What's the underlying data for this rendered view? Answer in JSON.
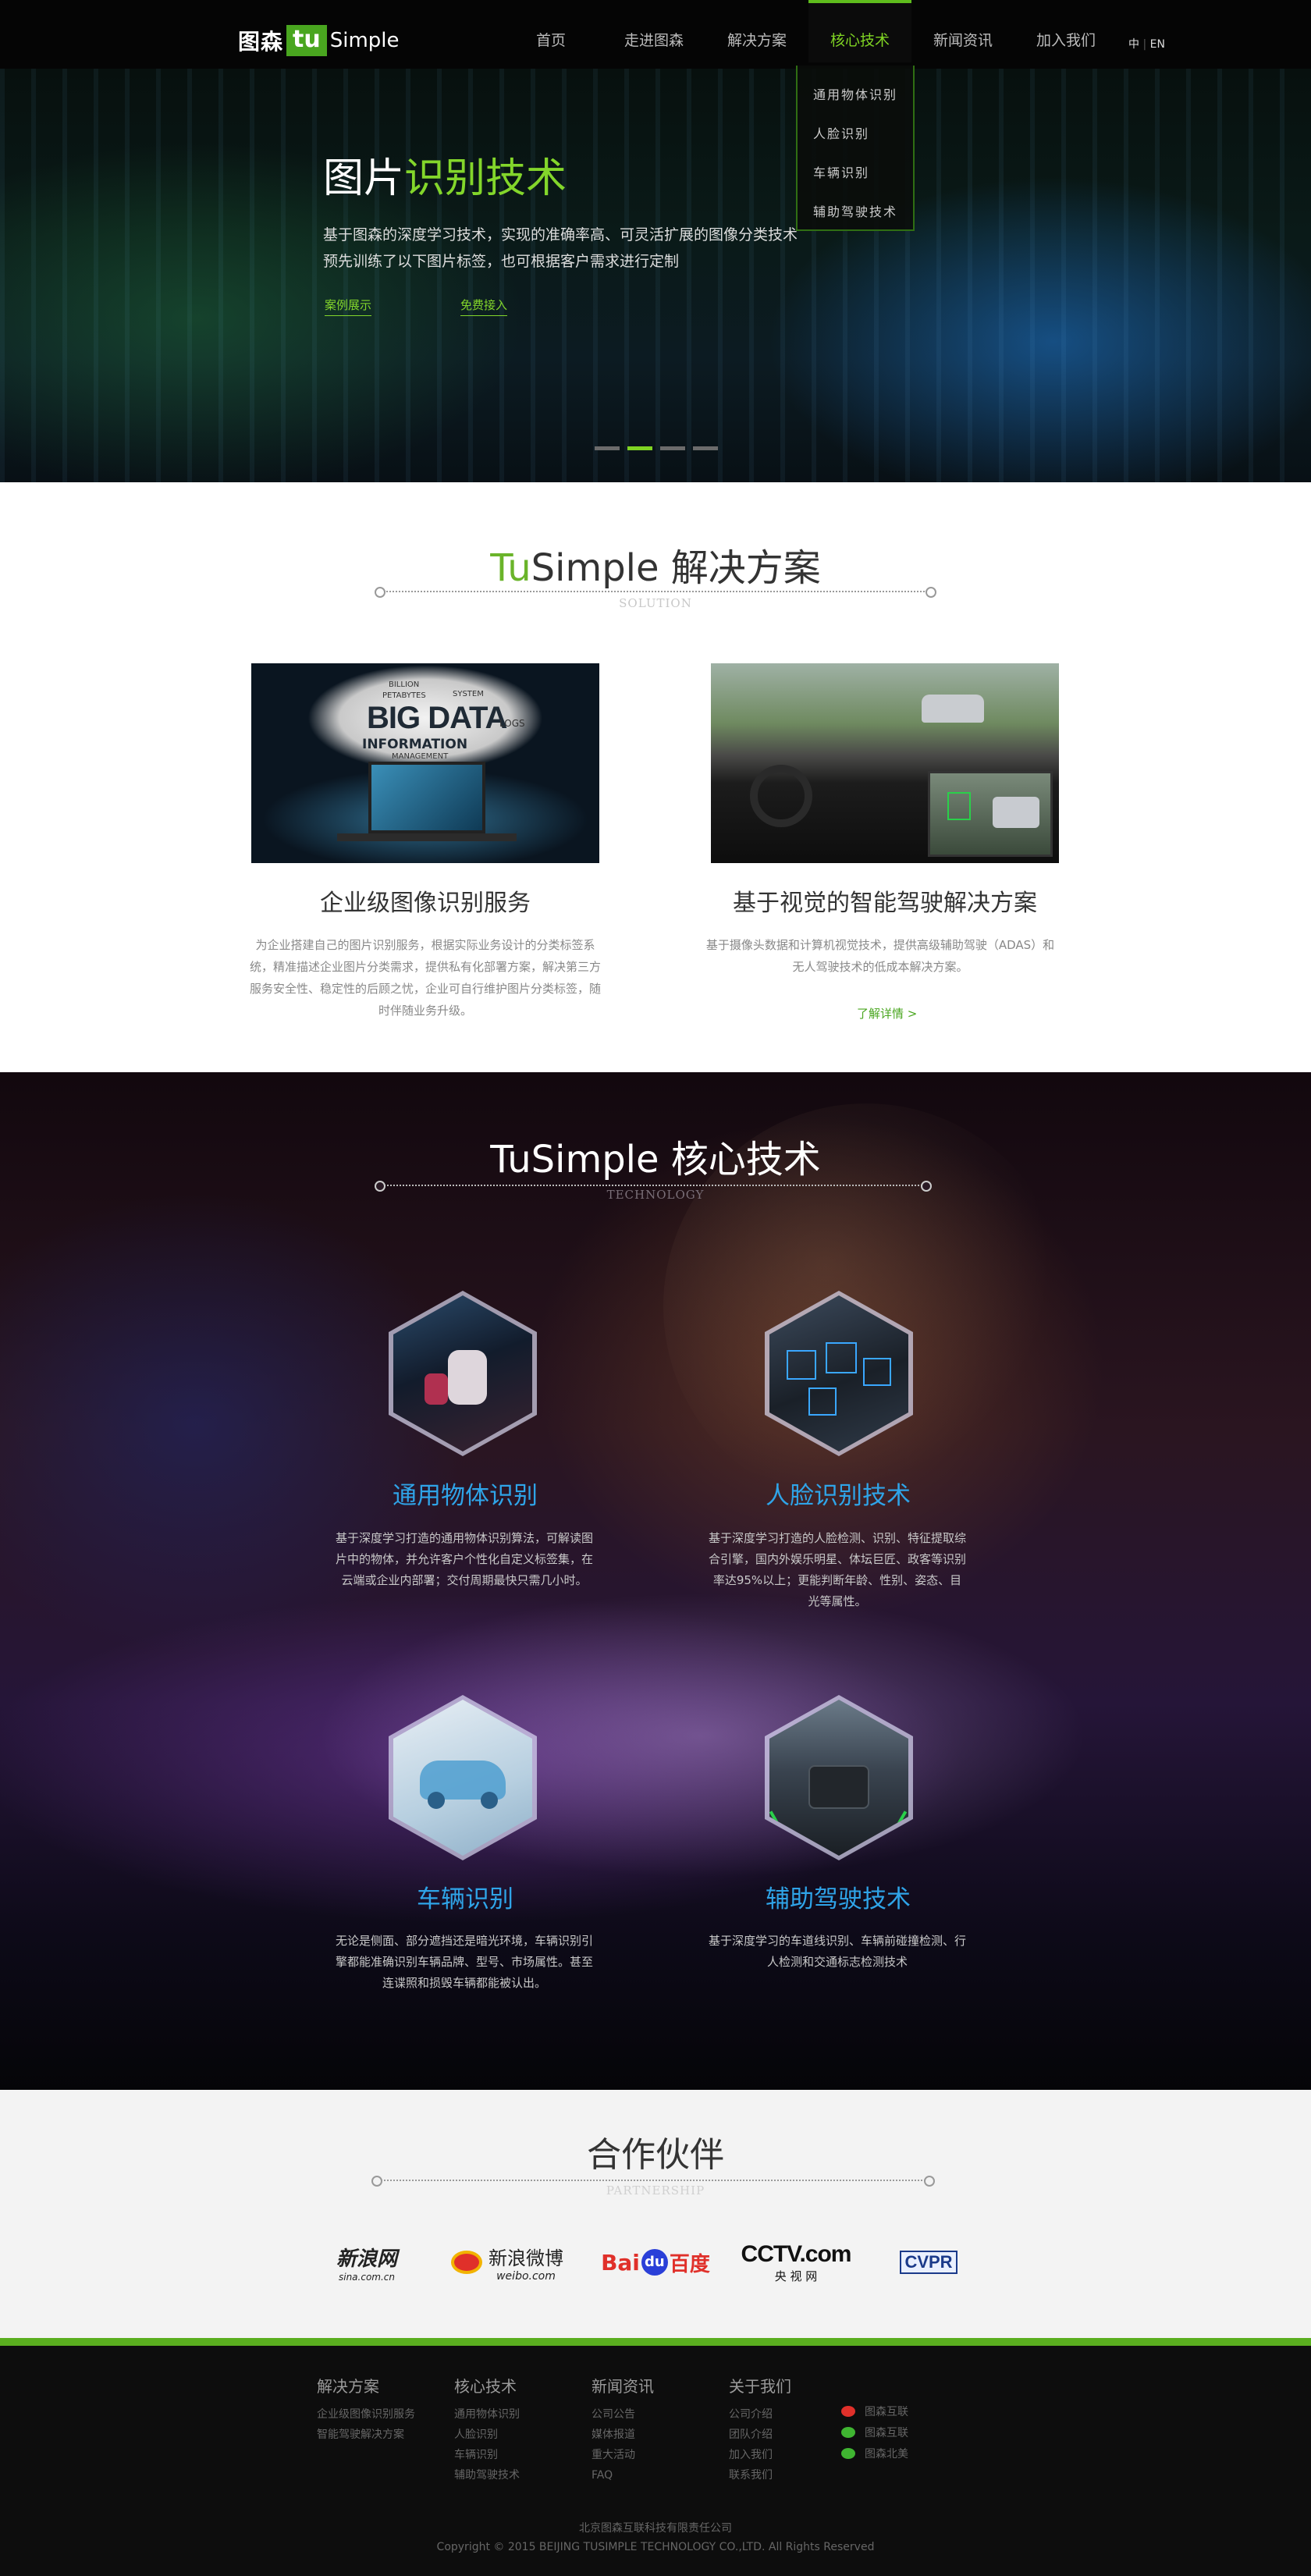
{
  "header": {
    "logo_cn": "图森",
    "logo_tu": "tu",
    "logo_en": "Simple",
    "nav": [
      {
        "label": "首页"
      },
      {
        "label": "走进图森"
      },
      {
        "label": "解决方案"
      },
      {
        "label": "核心技术",
        "active": true
      },
      {
        "label": "新闻资讯"
      },
      {
        "label": "加入我们"
      }
    ],
    "lang_cn": "中",
    "lang_sep": " | ",
    "lang_en": "EN",
    "dropdown": [
      "通用物体识别",
      "人脸识别",
      "车辆识别",
      "辅助驾驶技术"
    ]
  },
  "hero": {
    "title_white": "图片",
    "title_green": "识别技术",
    "desc_line1": "基于图森的深度学习技术，实现的准确率高、可灵活扩展的图像分类技术",
    "desc_line2": "预先训练了以下图片标签，也可根据客户需求进行定制",
    "link_cases": "案例展示",
    "link_trial": "免费接入",
    "slides": 4,
    "active_slide": 2
  },
  "solution": {
    "title_green": "Tu",
    "title_rest": "Simple 解决方案",
    "subtitle": "SOLUTION",
    "cards": [
      {
        "image_label": "BIG DATA",
        "image_words": [
          "BILLION",
          "PETABYTES",
          "SYSTEM",
          "INFORMATION",
          "MANAGEMENT",
          "LOGS"
        ],
        "caption": "企业级图像识别服务",
        "text": "为企业搭建自己的图片识别服务，根据实际业务设计的分类标签系统，精准描述企业图片分类需求，提供私有化部署方案，解决第三方服务安全性、稳定性的后顾之忧，企业可自行维护图片分类标签，随时伴随业务升级。"
      },
      {
        "caption": "基于视觉的智能驾驶解决方案",
        "text": "基于摄像头数据和计算机视觉技术，提供高级辅助驾驶（ADAS）和无人驾驶技术的低成本解决方案。",
        "more": "了解详情 >"
      }
    ]
  },
  "technology": {
    "title": "TuSimple 核心技术",
    "subtitle": "TECHNOLOGY",
    "items": [
      {
        "title": "通用物体识别",
        "text": "基于深度学习打造的通用物体识别算法，可解读图片中的物体，并允许客户个性化自定义标签集，在云端或企业内部署；交付周期最快只需几小时。",
        "icon": "robot-toys-icon"
      },
      {
        "title": "人脸识别技术",
        "text": "基于深度学习打造的人脸检测、识别、特征提取综合引擎，国内外娱乐明星、体坛巨匠、政客等识别率达95%以上；更能判断年龄、性别、姿态、目光等属性。",
        "icon": "face-detection-icon"
      },
      {
        "title": "车辆识别",
        "text": "无论是侧面、部分遮挡还是暗光环境，车辆识别引擎都能准确识别车辆品牌、型号、市场属性。甚至连谍照和损毁车辆都能被认出。",
        "icon": "car-xray-icon"
      },
      {
        "title": "辅助驾驶技术",
        "text": "基于深度学习的车道线识别、车辆前碰撞检测、行人检测和交通标志检测技术",
        "icon": "road-car-icon"
      }
    ]
  },
  "partners": {
    "title": "合作伙伴",
    "subtitle": "PARTNERSHIP",
    "logos": [
      {
        "name": "sina",
        "text": "新浪网",
        "sub": "sina.com.cn"
      },
      {
        "name": "weibo",
        "text": "新浪微博",
        "sub": "weibo.com"
      },
      {
        "name": "baidu",
        "text_a": "Bai",
        "text_b": "du",
        "text_c": "百度"
      },
      {
        "name": "cctv",
        "text": "CCTV.com",
        "sub": "央 视 网"
      },
      {
        "name": "cvpr",
        "text": "CVPR"
      }
    ]
  },
  "footer": {
    "columns": [
      {
        "title": "解决方案",
        "items": [
          "企业级图像识别服务",
          "智能驾驶解决方案"
        ]
      },
      {
        "title": "核心技术",
        "items": [
          "通用物体识别",
          "人脸识别",
          "车辆识别",
          "辅助驾驶技术"
        ]
      },
      {
        "title": "新闻资讯",
        "items": [
          "公司公告",
          "媒体报道",
          "重大活动",
          "FAQ"
        ]
      },
      {
        "title": "关于我们",
        "items": [
          "公司介绍",
          "团队介绍",
          "加入我们",
          "联系我们"
        ]
      }
    ],
    "social": [
      {
        "label": "图森互联",
        "icon": "weibo-icon",
        "color": "#e0302a"
      },
      {
        "label": "图森互联",
        "icon": "wechat-icon",
        "color": "#3fb531"
      },
      {
        "label": "图森北美",
        "icon": "wechat-icon",
        "color": "#3fb531"
      }
    ],
    "company": "北京图森互联科技有限责任公司",
    "copyright": "Copyright © 2015 BEIJING TUSIMPLE TECHNOLOGY CO.,LTD. All Rights Reserved"
  },
  "colors": {
    "brand_green": "#5aae1f",
    "accent_green": "#7fd323",
    "tech_blue": "#2fa4e8"
  }
}
